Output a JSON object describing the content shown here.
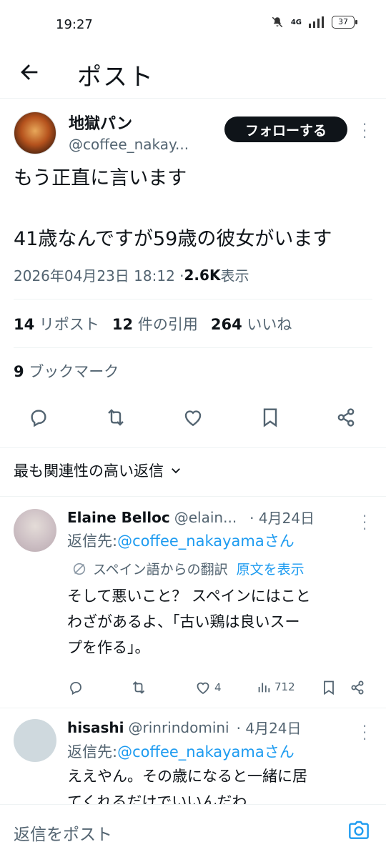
{
  "status_bar": {
    "time": "19:27",
    "network": "4G",
    "battery": "37"
  },
  "header": {
    "title": "ポスト"
  },
  "post": {
    "author_name": "地獄パン",
    "author_handle": "@coffee_nakay...",
    "follow_label": "フォローする",
    "text_line1": "もう正直に言います",
    "text_line2": "41歳なんですが59歳の彼女がいます",
    "timestamp": "2026年04月23日 18:12 · ",
    "views_count": "2.6K",
    "views_label": " 表示",
    "reposts_count": "14",
    "reposts_label": "リポスト",
    "quotes_count": "12",
    "quotes_label": "件の引用",
    "likes_count": "264",
    "likes_label": "いいね",
    "bookmarks_count": "9",
    "bookmarks_label": "ブックマーク"
  },
  "sort": {
    "label": "最も関連性の高い返信"
  },
  "replies": [
    {
      "name": "Elaine Belloc",
      "handle": "@elain...",
      "date": "· 4月24日",
      "reply_to_prefix": "返信先: ",
      "reply_to": "@coffee_nakayamaさん",
      "translated_from": "スペイン語からの翻訳",
      "show_original": "原文を表示",
      "text_line1": "そして悪いこと？ スペインにはこと",
      "text_line2": "わざがあるよ、「古い鶏は良いスー",
      "text_line3": "プを作る」。",
      "likes": "4",
      "views": "712"
    },
    {
      "name": "hisashi",
      "handle": "@rinrindomini",
      "date": "· 4月24日",
      "reply_to_prefix": "返信先: ",
      "reply_to": "@coffee_nakayamaさん",
      "text_line1": "ええやん。その歳になると一緒に居",
      "text_line2": "てくれるだけでいいんだわ"
    }
  ],
  "compose": {
    "placeholder": "返信をポスト"
  },
  "icons": {
    "back": "arrow-left-icon",
    "reply": "reply-icon",
    "repost": "repost-icon",
    "like": "heart-icon",
    "bookmark": "bookmark-icon",
    "share": "share-icon",
    "camera": "camera-icon"
  },
  "colors": {
    "link": "#1d9bf0",
    "muted": "#536471",
    "text": "#0f1419"
  }
}
